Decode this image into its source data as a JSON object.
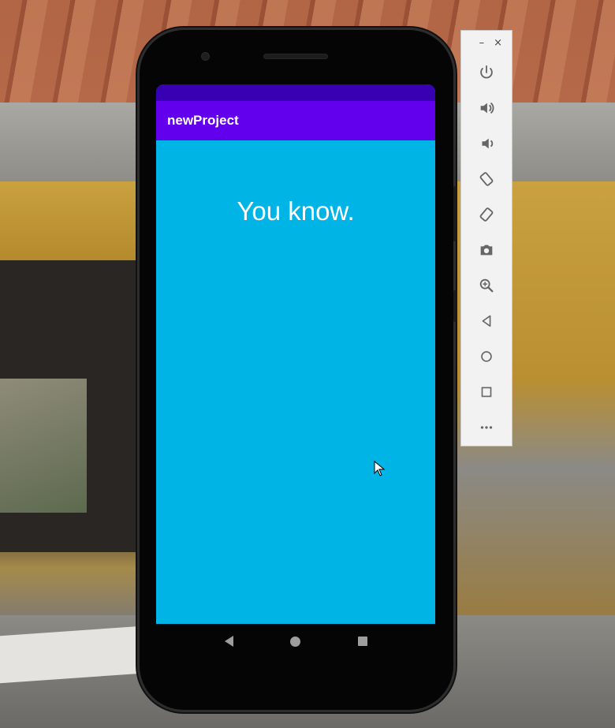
{
  "app": {
    "title": "newProject",
    "main_text": "You know."
  },
  "colors": {
    "status_bar": "#3700b3",
    "app_bar": "#6200ee",
    "screen_background": "#00b4e6",
    "text": "#ffffff"
  },
  "navigation": {
    "back_icon": "back-triangle-icon",
    "home_icon": "home-circle-icon",
    "recents_icon": "recents-square-icon"
  },
  "emulator_toolbar": {
    "minimize_label": "–",
    "close_label": "×",
    "buttons": [
      "power-icon",
      "volume-up-icon",
      "volume-down-icon",
      "rotate-left-icon",
      "rotate-right-icon",
      "camera-icon",
      "zoom-icon",
      "back-icon",
      "home-icon",
      "overview-icon",
      "more-icon"
    ]
  }
}
